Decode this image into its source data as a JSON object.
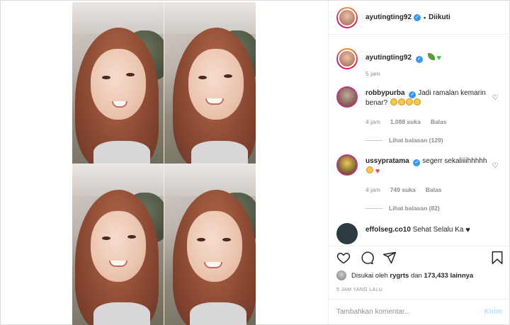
{
  "post": {
    "author": "ayutingting92",
    "follow_status": "Diikuti",
    "follow_sep": "•"
  },
  "caption": {
    "username": "ayutingting92",
    "time": "5 jam"
  },
  "comments": [
    {
      "username": "robbypurba",
      "text": "Jadi ramalan kemarin benar?",
      "time": "4 jam",
      "likes": "1.088 suka",
      "reply": "Balas",
      "view_replies": "Lihat balasan (129)"
    },
    {
      "username": "ussypratama",
      "text": "segerr sekaliiiihhhhh",
      "time": "4 jam",
      "likes": "749 suka",
      "reply": "Balas",
      "view_replies": "Lihat balasan (82)"
    },
    {
      "username": "effolseg.co10",
      "text": "Sehat Selalu Ka"
    }
  ],
  "likes": {
    "prefix": "Disukai oleh",
    "user": "rygrts",
    "middle": "dan",
    "count": "173,433 lainnya"
  },
  "timestamp": "5 JAM YANG LALU",
  "add_comment": {
    "placeholder": "Tambahkan komentar...",
    "send": "Kirim"
  },
  "colors": {
    "link_blue": "#3897f0",
    "send_disabled": "#b2dffc",
    "heart_red": "#ed4956",
    "muted": "#8e8e8e"
  },
  "icons": [
    "heart-icon",
    "comment-icon",
    "share-icon",
    "bookmark-icon",
    "verified-icon"
  ]
}
